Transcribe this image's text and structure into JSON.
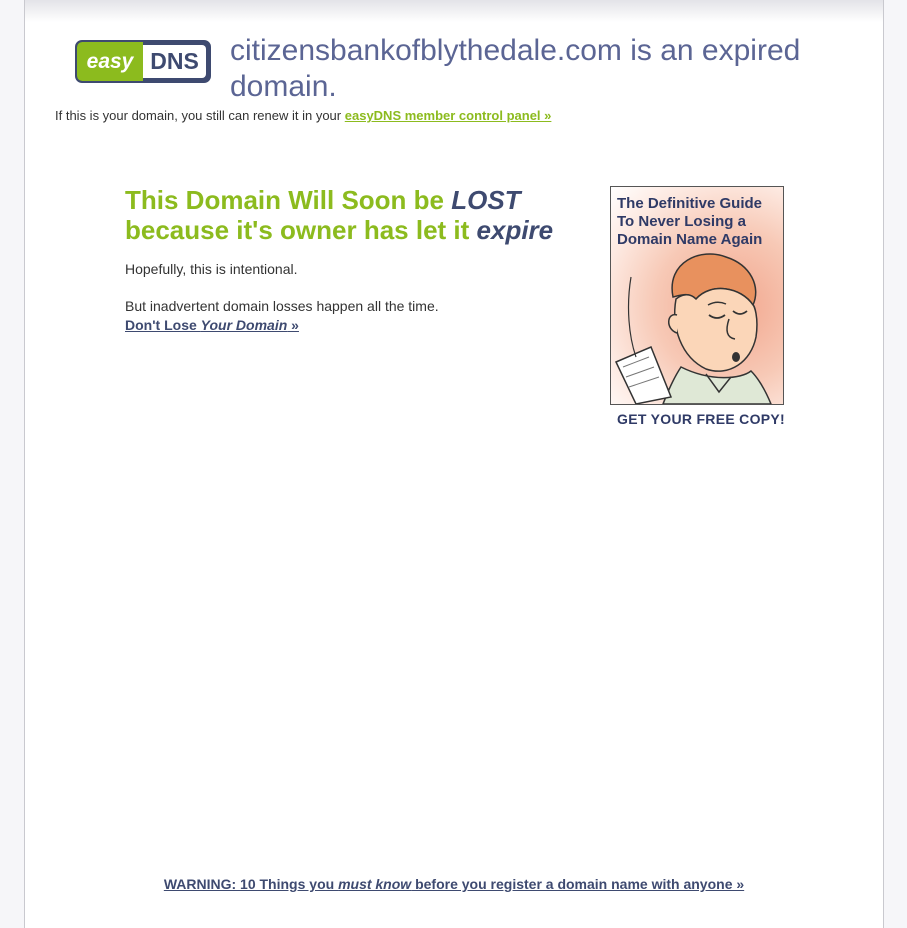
{
  "logo": {
    "easy": "easy",
    "dns": "DNS"
  },
  "headline": "citizensbankofblythedale.com is an expired domain.",
  "renew": {
    "prefix": "If this is your domain, you still can renew it in your",
    "link": "easyDNS member control panel »"
  },
  "lost": {
    "line1_green": "This Domain Will Soon be ",
    "line1_emph": "LOST",
    "line2_green": "because it's owner has let it ",
    "line2_emph": "expire"
  },
  "para1": "Hopefully, this is intentional.",
  "para2": "But inadvertent domain losses happen all the time.",
  "dont_lose": {
    "prefix": "Don't Lose ",
    "emph": "Your Domain",
    "suffix": " »"
  },
  "book": {
    "title": "The Definitive Guide To Never Losing a Domain Name Again",
    "cta": "GET YOUR FREE COPY!"
  },
  "warning": {
    "prefix": "WARNING: 10 Things you ",
    "emph": "must know",
    "suffix": " before you register a domain name with anyone »"
  },
  "colors": {
    "green": "#8cbb1e",
    "navy": "#3e4a70",
    "headline": "#5b6594"
  }
}
